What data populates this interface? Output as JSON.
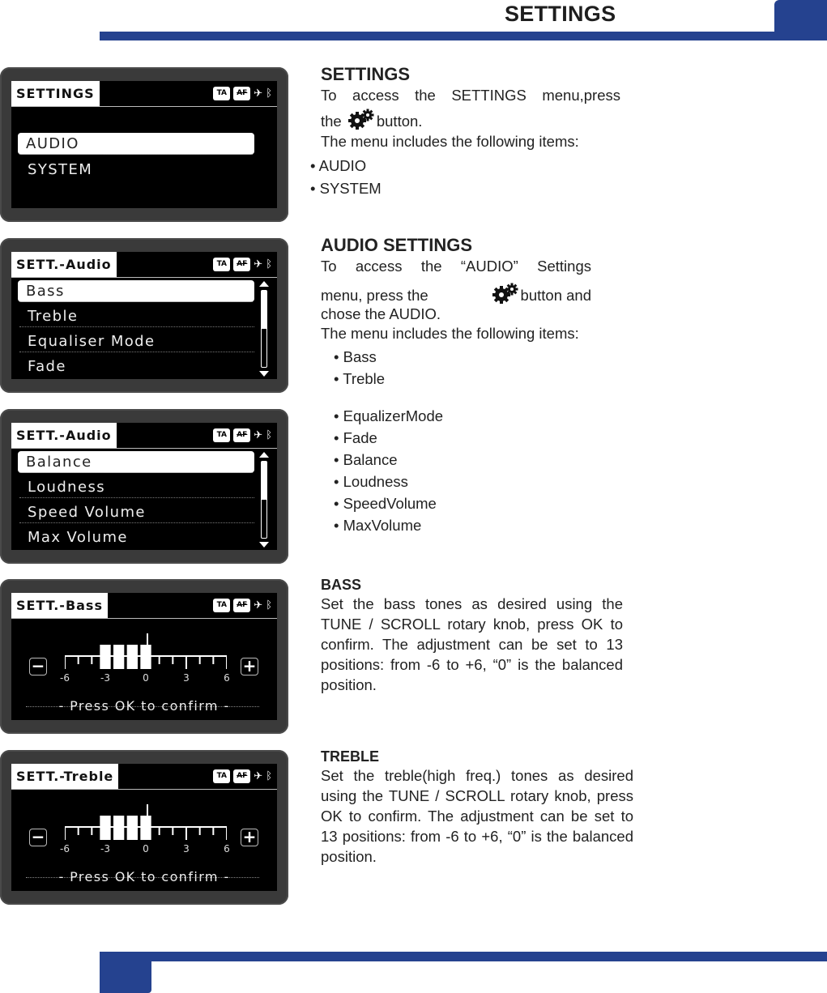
{
  "header": {
    "title": "SETTINGS"
  },
  "colors": {
    "brand_blue": "#25428f"
  },
  "status_icons": {
    "ta": "TA",
    "af": "AF",
    "mute_icon": "mute-icon",
    "bluetooth_icon": "bluetooth-icon"
  },
  "screens": {
    "settings": {
      "title": "SETTINGS",
      "items": [
        "AUDIO",
        "SYSTEM"
      ],
      "selected": "AUDIO"
    },
    "audio1": {
      "title": "SETT.-Audio",
      "items": [
        "Bass",
        "Treble",
        "Equaliser Mode",
        "Fade"
      ],
      "selected": "Bass",
      "scroll_fraction": 0.5
    },
    "audio2": {
      "title": "SETT.-Audio",
      "items": [
        "Balance",
        "Loudness",
        "Speed Volume",
        "Max Volume"
      ],
      "selected": "Balance",
      "scroll_fraction": 0.5
    },
    "bass": {
      "title": "SETT.-Bass",
      "minus": "−",
      "plus": "+",
      "scale_min": -6,
      "scale_max": 6,
      "tick_labels": [
        "-6",
        "-3",
        "0",
        "3",
        "6"
      ],
      "filled_positions": [
        -3,
        -2,
        -1,
        0
      ],
      "center_marker": 0,
      "confirm": "- Press OK to confirm -"
    },
    "treble": {
      "title": "SETT.-Treble",
      "minus": "−",
      "plus": "+",
      "scale_min": -6,
      "scale_max": 6,
      "tick_labels": [
        "-6",
        "-3",
        "0",
        "3",
        "6"
      ],
      "filled_positions": [
        -3,
        -2,
        -1,
        0
      ],
      "center_marker": 0,
      "confirm": "- Press OK to confirm -"
    }
  },
  "sections": {
    "settings": {
      "heading": "SETTINGS",
      "line1": "To access the SETTINGS menu,press",
      "line2_pre": "the",
      "line2_post": "button.",
      "line3": "The menu includes the following items:",
      "items": [
        "AUDIO",
        "SYSTEM"
      ]
    },
    "audio": {
      "heading": "AUDIO SETTINGS",
      "line1": "To access the “AUDIO” Settings",
      "line2_pre": "menu, press the",
      "line2_post": "button and",
      "line3": "chose the AUDIO.",
      "line4": "The menu includes the following items:",
      "items": [
        "Bass",
        "Treble",
        "EqualizerMode",
        "Fade",
        "Balance",
        "Loudness",
        "SpeedVolume",
        "MaxVolume"
      ]
    },
    "bass": {
      "heading": "BASS",
      "body": "Set the bass tones as desired using the TUNE / SCROLL rotary knob, press OK to confirm. The adjustment can be set to 13 positions: from -6 to +6, “0” is the balanced position."
    },
    "treble": {
      "heading": "TREBLE",
      "body": "Set the treble(high freq.) tones as desired using the TUNE / SCROLL rotary knob, press OK to confirm. The adjustment can be set to 13 positions: from -6 to +6, “0” is the balanced position."
    }
  }
}
